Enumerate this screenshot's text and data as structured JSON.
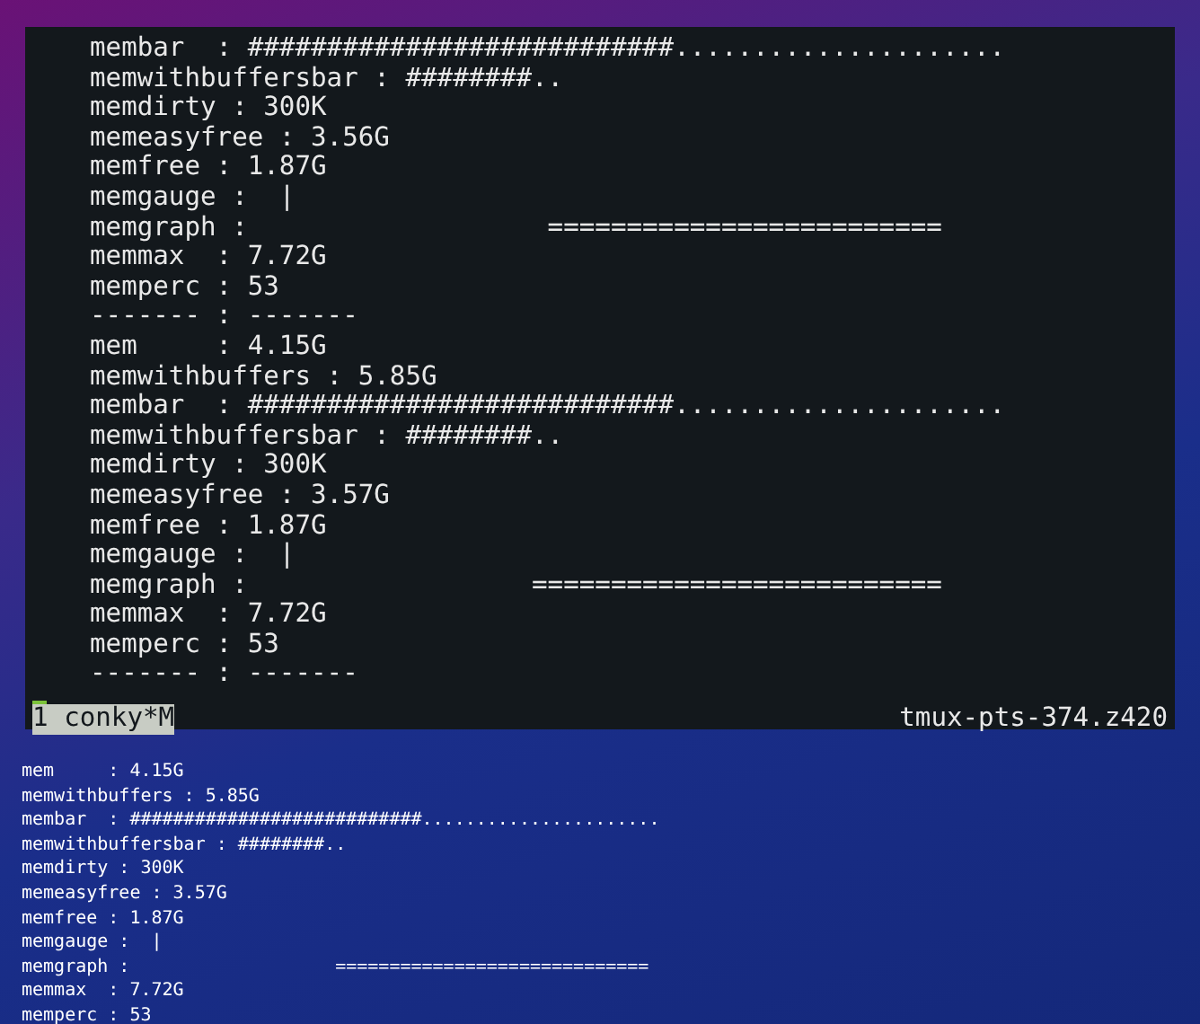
{
  "terminal": {
    "lines": [
      "membar  : ###########################.....................",
      "memwithbuffersbar : ########..",
      "memdirty : 300K",
      "memeasyfree : 3.56G",
      "memfree : 1.87G",
      "memgauge :  |",
      "memgraph :                   =========================",
      "memmax  : 7.72G",
      "memperc : 53",
      "------- : -------",
      "mem     : 4.15G",
      "memwithbuffers : 5.85G",
      "membar  : ###########################.....................",
      "memwithbuffersbar : ########..",
      "memdirty : 300K",
      "memeasyfree : 3.57G",
      "memfree : 1.87G",
      "memgauge :  |",
      "memgraph :                  ==========================",
      "memmax  : 7.72G",
      "memperc : 53",
      "------- : -------"
    ],
    "status_bar": {
      "window_tab": "1 conky*M",
      "session": "tmux-pts-374.z420"
    }
  },
  "desktop_conky": {
    "lines": [
      "mem     : 4.15G",
      "memwithbuffers : 5.85G",
      "membar  : ###########################......................",
      "memwithbuffersbar : ########..",
      "memdirty : 300K",
      "memeasyfree : 3.57G",
      "memfree : 1.87G",
      "memgauge :  |",
      "memgraph :                   =============================",
      "memmax  : 7.72G",
      "memperc : 53"
    ]
  }
}
